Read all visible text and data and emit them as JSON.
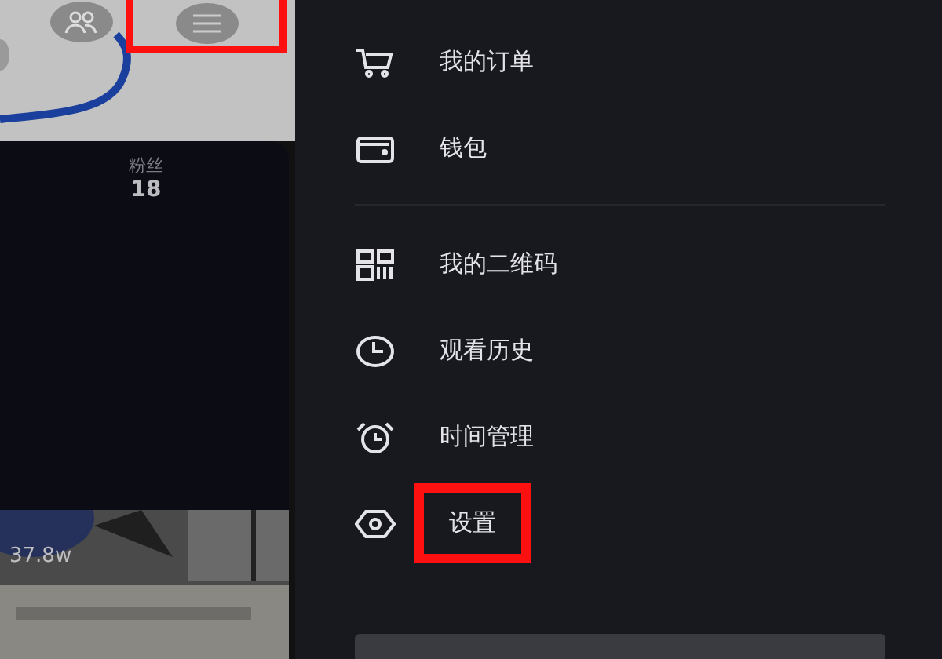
{
  "profile": {
    "header_buttons": [
      {
        "kind": "friends",
        "highlighted": false
      },
      {
        "kind": "menu",
        "highlighted": true
      }
    ],
    "stats": [
      {
        "label": "粉丝",
        "value": "18"
      }
    ],
    "video": {
      "kind": "picture",
      "views": "37.8w"
    }
  },
  "drawer": {
    "groups": [
      [
        {
          "kind": "cart",
          "label": "我的订单",
          "highlighted": false
        },
        {
          "kind": "wallet",
          "label": "钱包",
          "highlighted": false
        }
      ],
      [
        {
          "kind": "qr",
          "label": "我的二维码",
          "highlighted": false
        },
        {
          "kind": "clock",
          "label": "观看历史",
          "highlighted": false
        },
        {
          "kind": "alarm",
          "label": "时间管理",
          "highlighted": false
        },
        {
          "kind": "hex",
          "label": "设置",
          "highlighted": true
        }
      ]
    ]
  }
}
